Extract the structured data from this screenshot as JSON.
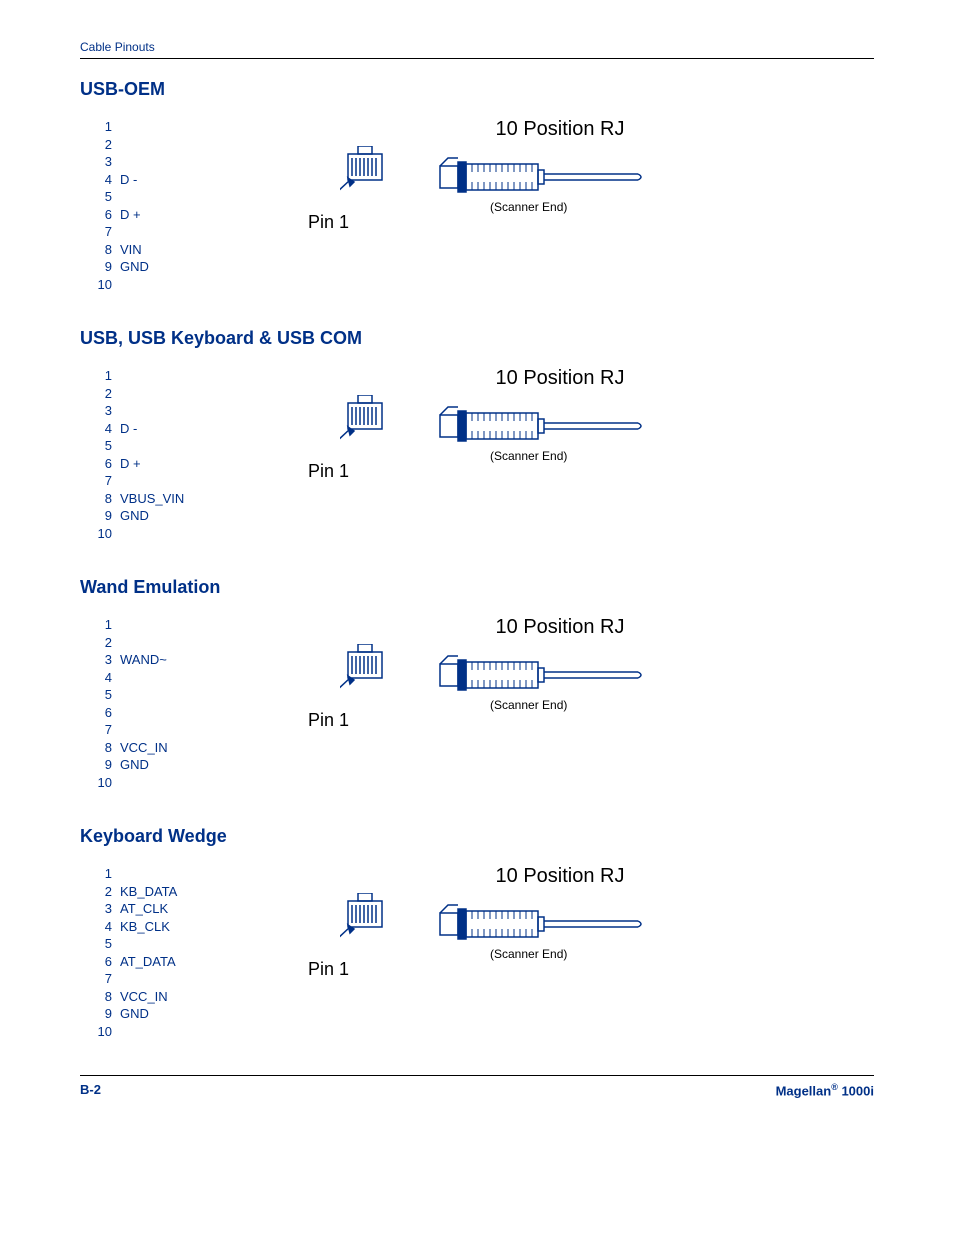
{
  "header": "Cable Pinouts",
  "sections": [
    {
      "title": "USB-OEM",
      "pins": [
        {
          "n": "1",
          "name": ""
        },
        {
          "n": "2",
          "name": ""
        },
        {
          "n": "3",
          "name": ""
        },
        {
          "n": "4",
          "name": "D -"
        },
        {
          "n": "5",
          "name": ""
        },
        {
          "n": "6",
          "name": "D +"
        },
        {
          "n": "7",
          "name": ""
        },
        {
          "n": "8",
          "name": "VIN"
        },
        {
          "n": "9",
          "name": "GND"
        },
        {
          "n": "10",
          "name": ""
        }
      ],
      "diagram_title": "10 Position RJ",
      "pin1": "Pin 1",
      "scanner_end": "(Scanner End)"
    },
    {
      "title": "USB, USB Keyboard & USB COM",
      "pins": [
        {
          "n": "1",
          "name": ""
        },
        {
          "n": "2",
          "name": ""
        },
        {
          "n": "3",
          "name": ""
        },
        {
          "n": "4",
          "name": "D -"
        },
        {
          "n": "5",
          "name": ""
        },
        {
          "n": "6",
          "name": "D +"
        },
        {
          "n": "7",
          "name": ""
        },
        {
          "n": "8",
          "name": "VBUS_VIN"
        },
        {
          "n": "9",
          "name": "GND"
        },
        {
          "n": "10",
          "name": ""
        }
      ],
      "diagram_title": "10 Position RJ",
      "pin1": "Pin 1",
      "scanner_end": "(Scanner End)"
    },
    {
      "title": "Wand Emulation",
      "pins": [
        {
          "n": "1",
          "name": ""
        },
        {
          "n": "2",
          "name": ""
        },
        {
          "n": "3",
          "name": "WAND~"
        },
        {
          "n": "4",
          "name": ""
        },
        {
          "n": "5",
          "name": ""
        },
        {
          "n": "6",
          "name": ""
        },
        {
          "n": "7",
          "name": ""
        },
        {
          "n": "8",
          "name": "VCC_IN"
        },
        {
          "n": "9",
          "name": "GND"
        },
        {
          "n": "10",
          "name": ""
        }
      ],
      "diagram_title": "10 Position RJ",
      "pin1": "Pin 1",
      "scanner_end": "(Scanner End)"
    },
    {
      "title": "Keyboard Wedge",
      "pins": [
        {
          "n": "1",
          "name": ""
        },
        {
          "n": "2",
          "name": "KB_DATA"
        },
        {
          "n": "3",
          "name": "AT_CLK"
        },
        {
          "n": "4",
          "name": "KB_CLK"
        },
        {
          "n": "5",
          "name": ""
        },
        {
          "n": "6",
          "name": "AT_DATA"
        },
        {
          "n": "7",
          "name": ""
        },
        {
          "n": "8",
          "name": "VCC_IN"
        },
        {
          "n": "9",
          "name": "GND"
        },
        {
          "n": "10",
          "name": ""
        }
      ],
      "diagram_title": "10 Position RJ",
      "pin1": "Pin 1",
      "scanner_end": "(Scanner End)"
    }
  ],
  "footer": {
    "page": "B-2",
    "product_a": "Magellan",
    "product_b": " 1000i"
  }
}
